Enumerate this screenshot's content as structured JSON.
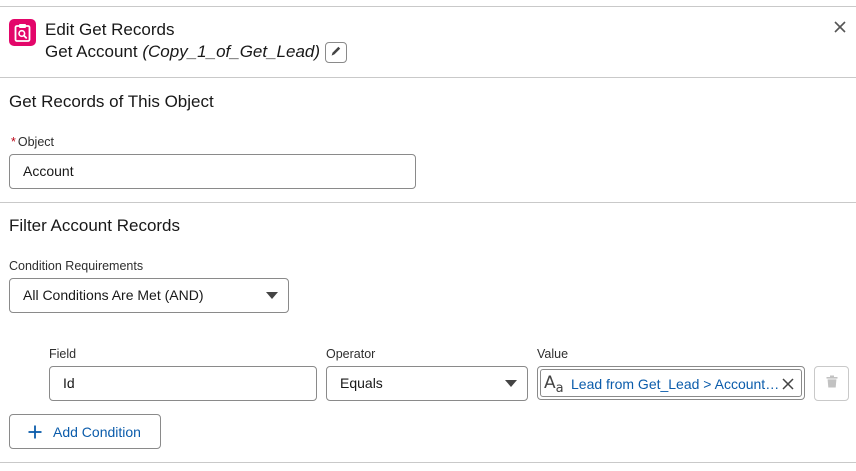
{
  "header": {
    "title": "Edit Get Records",
    "element_label": "Get Account",
    "api_name": "(Copy_1_of_Get_Lead)",
    "icon": "get-records-icon",
    "icon_color": "#e3066a"
  },
  "object_section": {
    "title": "Get Records of This Object",
    "object_label": "Object",
    "required_marker": "*",
    "object_value": "Account"
  },
  "filter_section": {
    "title": "Filter Account Records",
    "condition_requirements_label": "Condition Requirements",
    "condition_requirements_value": "All Conditions Are Met (AND)",
    "columns": {
      "field": "Field",
      "operator": "Operator",
      "value": "Value"
    },
    "conditions": [
      {
        "field": "Id",
        "operator": "Equals",
        "value": "Lead from Get_Lead > Account ID",
        "value_type_icon": "text-type-icon",
        "value_type_glyph": "A",
        "value_type_glyph_sub": "a"
      }
    ],
    "add_condition_label": "Add Condition"
  },
  "colors": {
    "accent": "#0b5cab",
    "border": "#8a8a8a",
    "required": "#ba0517"
  }
}
